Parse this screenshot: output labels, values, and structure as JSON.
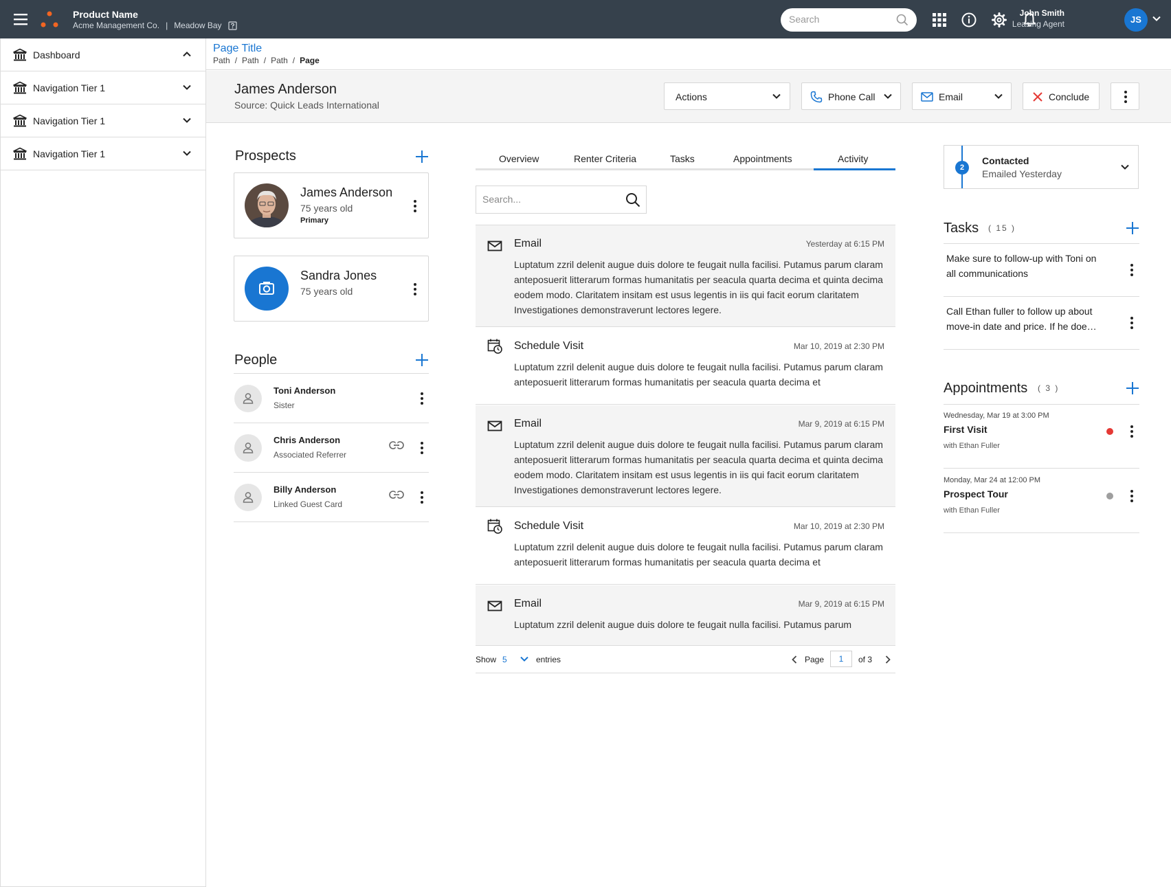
{
  "colors": {
    "topbar": "#36414c",
    "accent": "#1976d2",
    "logo_orange": "#f26522",
    "danger": "#e53935",
    "inactive_dot": "#9e9e9e"
  },
  "topbar": {
    "product_name": "Product Name",
    "company": "Acme Management Co.",
    "separator": "|",
    "property": "Meadow Bay",
    "search_placeholder": "Search",
    "icons": [
      "grid-icon",
      "info-icon",
      "gear-icon",
      "bell-icon"
    ],
    "user": {
      "name": "John Smith",
      "role": "Leasing Agent",
      "initials": "JS"
    }
  },
  "sidebar": {
    "items": [
      {
        "label": "Dashboard",
        "icon": "bank-icon",
        "expanded": true
      },
      {
        "label": "Navigation Tier 1",
        "icon": "bank-icon",
        "expanded": false
      },
      {
        "label": "Navigation Tier 1",
        "icon": "bank-icon",
        "expanded": false
      },
      {
        "label": "Navigation Tier 1",
        "icon": "bank-icon",
        "expanded": false
      }
    ]
  },
  "page": {
    "title": "Page Title",
    "breadcrumb": [
      "Path",
      "Path",
      "Path",
      "Page"
    ],
    "breadcrumb_sep": "/"
  },
  "record": {
    "name": "James Anderson",
    "source": "Source: Quick Leads International",
    "buttons": {
      "actions": "Actions",
      "phone": "Phone Call",
      "email": "Email",
      "conclude": "Conclude"
    }
  },
  "prospects": {
    "title": "Prospects",
    "items": [
      {
        "name": "James Anderson",
        "age": "75 years old",
        "tag": "Primary"
      },
      {
        "name": "Sandra Jones",
        "age": "75 years old"
      }
    ]
  },
  "people": {
    "title": "People",
    "items": [
      {
        "name": "Toni Anderson",
        "relation": "Sister",
        "linked": false
      },
      {
        "name": "Chris Anderson",
        "relation": "Associated Referrer",
        "linked": true
      },
      {
        "name": "Billy Anderson",
        "relation": "Linked Guest Card",
        "linked": true
      }
    ]
  },
  "tabs": {
    "items": [
      "Overview",
      "Renter Criteria",
      "Tasks",
      "Appointments",
      "Activity"
    ],
    "active": "Activity"
  },
  "activity": {
    "search_placeholder": "Search...",
    "items": [
      {
        "type": "Email",
        "icon": "mail-icon",
        "date": "Yesterday at 6:15 PM",
        "body": "Luptatum zzril delenit augue duis dolore te feugait nulla facilisi. Putamus parum claram anteposuerit litterarum formas humanitatis per seacula quarta decima et quinta decima eodem modo. Claritatem insitam est usus legentis in iis qui facit eorum claritatem Investigationes demonstraverunt lectores legere."
      },
      {
        "type": "Schedule Visit",
        "icon": "calendar-clock-icon",
        "date": "Mar 10, 2019 at 2:30 PM",
        "body": "Luptatum zzril delenit augue duis dolore te feugait nulla facilisi. Putamus parum claram anteposuerit litterarum formas humanitatis per seacula quarta decima et"
      },
      {
        "type": "Email",
        "icon": "mail-icon",
        "date": "Mar 9, 2019 at 6:15 PM",
        "body": "Luptatum zzril delenit augue duis dolore te feugait nulla facilisi. Putamus parum claram anteposuerit litterarum formas humanitatis per seacula quarta decima et quinta decima eodem modo. Claritatem insitam est usus legentis in iis qui facit eorum claritatem Investigationes demonstraverunt lectores legere."
      },
      {
        "type": "Schedule Visit",
        "icon": "calendar-clock-icon",
        "date": "Mar 10, 2019 at 2:30 PM",
        "body": "Luptatum zzril delenit augue duis dolore te feugait nulla facilisi. Putamus parum claram anteposuerit litterarum formas humanitatis per seacula quarta decima et"
      },
      {
        "type": "Email",
        "icon": "mail-icon",
        "date": "Mar 9, 2019 at 6:15 PM",
        "body": "Luptatum zzril delenit augue duis dolore te feugait nulla facilisi. Putamus parum"
      }
    ],
    "pager": {
      "show": "Show",
      "count": "5",
      "entries": "entries",
      "page_label": "Page",
      "page": "1",
      "of": "of 3"
    }
  },
  "status": {
    "step": "2",
    "title": "Contacted",
    "subtitle": "Emailed Yesterday"
  },
  "tasks": {
    "title": "Tasks",
    "count": "( 15 )",
    "items": [
      "Make sure to follow-up with Toni on all communications",
      "Call Ethan fuller to follow up about move-in date and price. If he doe…"
    ]
  },
  "appointments": {
    "title": "Appointments",
    "count": "( 3 )",
    "items": [
      {
        "date": "Wednesday, Mar 19 at 3:00 PM",
        "title": "First Visit",
        "with": "with Ethan Fuller",
        "status_color": "#e53935"
      },
      {
        "date": "Monday, Mar 24 at 12:00 PM",
        "title": "Prospect Tour",
        "with": "with Ethan Fuller",
        "status_color": "#9e9e9e"
      }
    ]
  }
}
